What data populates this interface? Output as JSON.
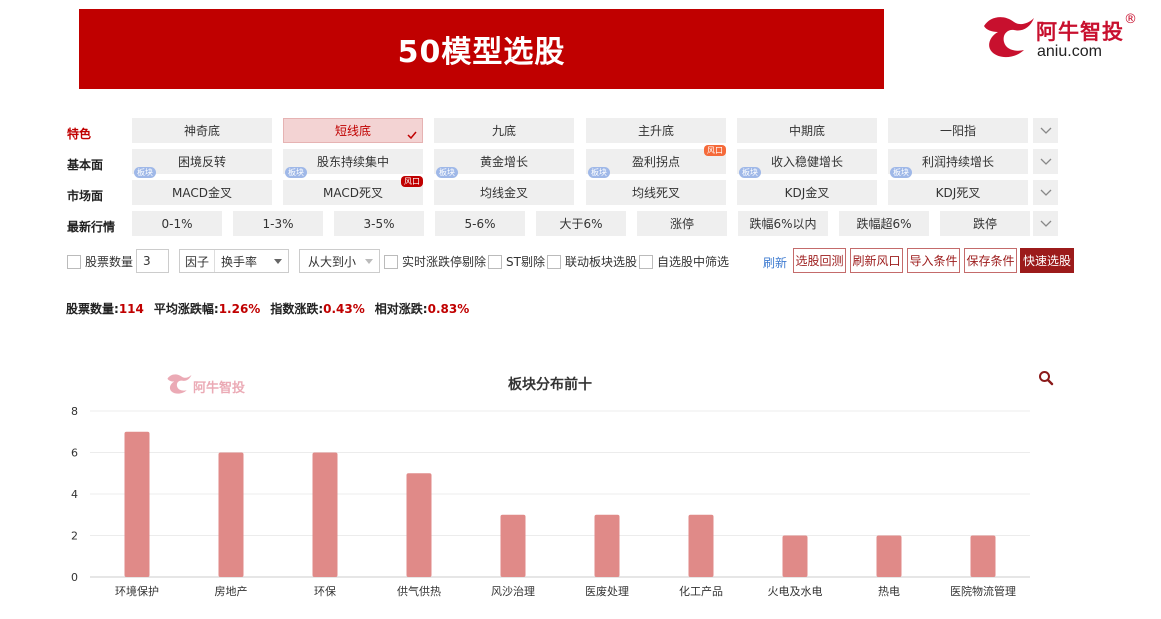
{
  "banner": {
    "title": "50模型选股"
  },
  "logo": {
    "brand": "阿牛智投",
    "reg": "®",
    "domain": "aniu.com"
  },
  "filters": {
    "rows": [
      {
        "label": "特色",
        "chips": [
          {
            "label": "神奇底"
          },
          {
            "label": "短线底",
            "active": true
          },
          {
            "label": "九底"
          },
          {
            "label": "主升底"
          },
          {
            "label": "中期底"
          },
          {
            "label": "一阳指"
          }
        ]
      },
      {
        "label": "基本面",
        "chips": [
          {
            "label": "困境反转",
            "tag": "板块"
          },
          {
            "label": "股东持续集中",
            "tag": "板块"
          },
          {
            "label": "黄金增长",
            "tag": "板块"
          },
          {
            "label": "盈利拐点",
            "tag": "板块",
            "risk": "风口"
          },
          {
            "label": "收入稳健增长",
            "tag": "板块"
          },
          {
            "label": "利润持续增长",
            "tag": "板块"
          }
        ]
      },
      {
        "label": "市场面",
        "chips": [
          {
            "label": "MACD金叉"
          },
          {
            "label": "MACD死叉",
            "risk": "风口"
          },
          {
            "label": "均线金叉"
          },
          {
            "label": "均线死叉"
          },
          {
            "label": "KDJ金叉"
          },
          {
            "label": "KDJ死叉"
          }
        ]
      },
      {
        "label": "最新行情",
        "chips": [
          {
            "label": "0-1%"
          },
          {
            "label": "1-3%"
          },
          {
            "label": "3-5%"
          },
          {
            "label": "5-6%"
          },
          {
            "label": "大于6%"
          },
          {
            "label": "涨停"
          },
          {
            "label": "跌幅6%以内"
          },
          {
            "label": "跌幅超6%"
          },
          {
            "label": "跌停"
          }
        ]
      }
    ]
  },
  "toolbar": {
    "stock_count_label": "股票数量",
    "stock_count_value": "3",
    "factor_label": "因子",
    "factor_value": "换手率",
    "order_value": "从大到小",
    "cb_realtime": "实时涨跌停剔除",
    "cb_st": "ST剔除",
    "cb_link": "联动板块选股",
    "cb_watch": "自选股中筛选",
    "refresh": "刷新",
    "btn_backtest": "选股回测",
    "btn_refresh_risk": "刷新风口",
    "btn_import": "导入条件",
    "btn_save": "保存条件",
    "btn_quick": "快速选股"
  },
  "stats": {
    "count_label": "股票数量:",
    "count_value": "114",
    "avg_label": "平均涨跌幅:",
    "avg_value": "1.26%",
    "index_label": "指数涨跌:",
    "index_value": "0.43%",
    "rel_label": "相对涨跌:",
    "rel_value": "0.83%"
  },
  "colors": {
    "accent": "#c00000",
    "bar": "#e08a88",
    "tag": "#9fb8e8"
  },
  "chart_data": {
    "type": "bar",
    "title": "板块分布前十",
    "categories": [
      "环境保护",
      "房地产",
      "环保",
      "供气供热",
      "风沙治理",
      "医废处理",
      "化工产品",
      "火电及水电",
      "热电",
      "医院物流管理"
    ],
    "values": [
      7,
      6,
      6,
      5,
      3,
      3,
      3,
      2,
      2,
      2
    ],
    "yticks": [
      0,
      2,
      4,
      6,
      8
    ],
    "ylim": [
      0,
      8
    ],
    "grid": true
  }
}
